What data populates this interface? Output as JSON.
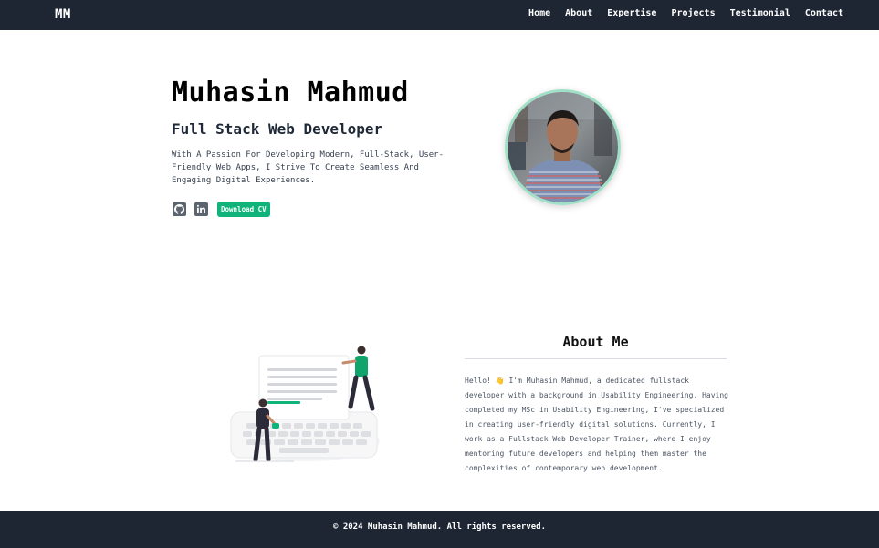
{
  "navbar": {
    "logo": "MM",
    "links": [
      "Home",
      "About",
      "Expertise",
      "Projects",
      "Testimonial",
      "Contact"
    ]
  },
  "hero": {
    "name": "Muhasin Mahmud",
    "role": "Full Stack Web Developer",
    "bio": "With A Passion For Developing Modern, Full-Stack, User-Friendly Web Apps, I Strive To Create Seamless And Engaging Digital Experiences.",
    "download_cv": "Download CV",
    "social_icons": [
      "github-icon",
      "linkedin-icon"
    ]
  },
  "about": {
    "title": "About Me",
    "text": "Hello! 👋 I'm Muhasin Mahmud, a dedicated fullstack developer with a background in Usability Engineering. Having completed my MSc in Usability Engineering, I've specialized in creating user-friendly digital solutions. Currently, I work as a Fullstack Web Developer Trainer, where I enjoy mentoring future developers and helping them master the complexities of contemporary web development."
  },
  "footer": {
    "text": "© 2024 Muhasin Mahmud. All rights reserved."
  },
  "colors": {
    "navbar_bg": "#1e2533",
    "accent": "#10b47a",
    "avatar_ring": "#9fe0c6"
  }
}
